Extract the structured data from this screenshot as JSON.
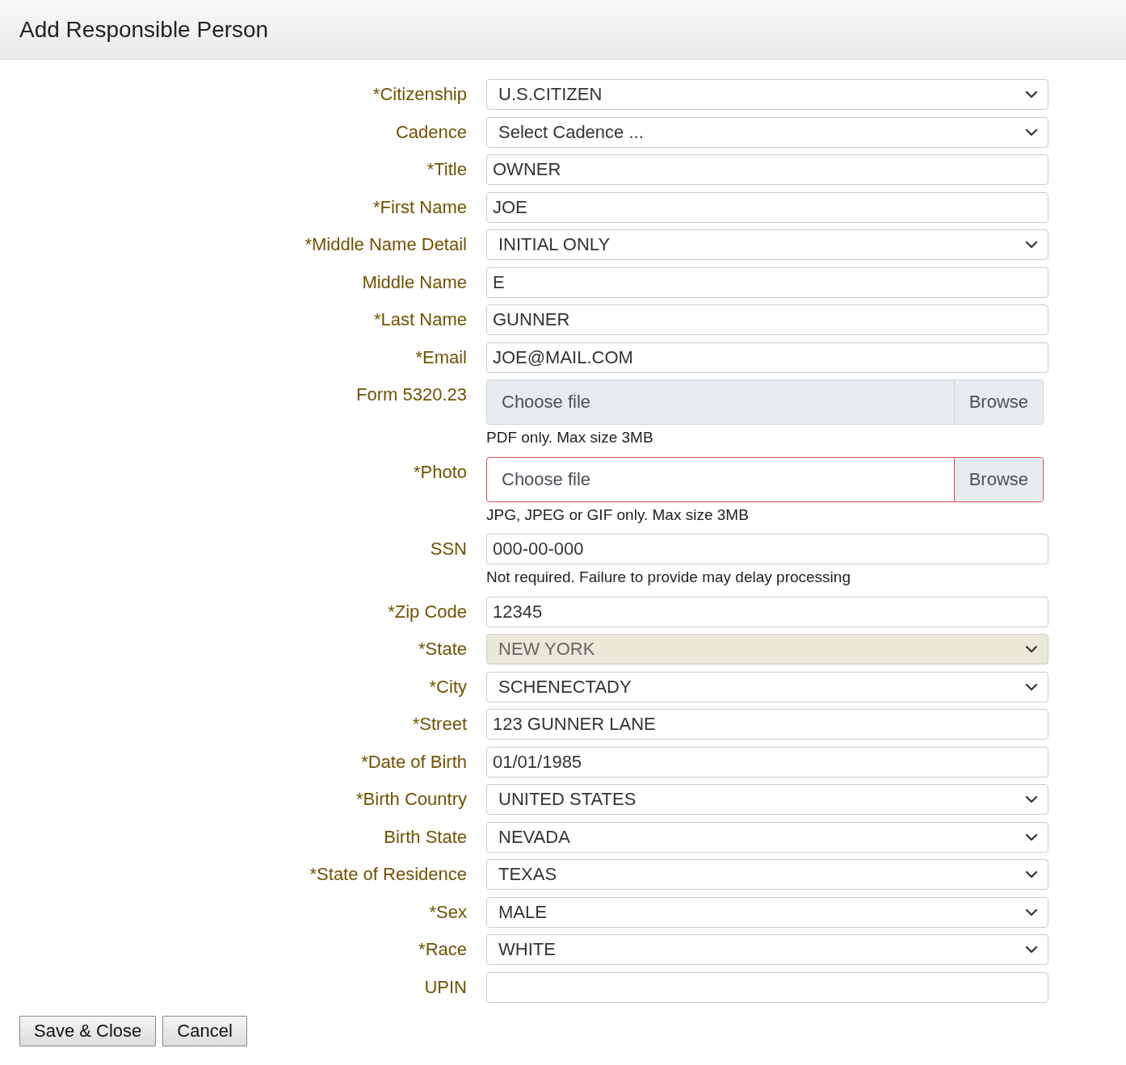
{
  "header": {
    "title": "Add Responsible Person"
  },
  "fields": [
    {
      "kind": "select",
      "label": "*Citizenship",
      "value": "U.S.CITIZEN",
      "disabled": false
    },
    {
      "kind": "select",
      "label": "Cadence",
      "value": "Select Cadence ...",
      "disabled": false
    },
    {
      "kind": "text",
      "label": "*Title",
      "value": "OWNER"
    },
    {
      "kind": "text",
      "label": "*First Name",
      "value": "JOE"
    },
    {
      "kind": "select",
      "label": "*Middle Name Detail",
      "value": "INITIAL ONLY",
      "disabled": false
    },
    {
      "kind": "text",
      "label": "Middle Name",
      "value": "E"
    },
    {
      "kind": "text",
      "label": "*Last Name",
      "value": "GUNNER"
    },
    {
      "kind": "text",
      "label": "*Email",
      "value": "JOE@MAIL.COM"
    },
    {
      "kind": "file",
      "label": "Form 5320.23",
      "value": "Choose file",
      "button": "Browse",
      "invalid": false,
      "help": "PDF only. Max size 3MB"
    },
    {
      "kind": "file",
      "label": "*Photo",
      "value": "Choose file",
      "button": "Browse",
      "invalid": true,
      "help": "JPG, JPEG or GIF only. Max size 3MB"
    },
    {
      "kind": "text",
      "label": "SSN",
      "value": "000-00-000",
      "help": "Not required. Failure to provide may delay processing"
    },
    {
      "kind": "text",
      "label": "*Zip Code",
      "value": "12345"
    },
    {
      "kind": "select",
      "label": "*State",
      "value": "NEW YORK",
      "disabled": true
    },
    {
      "kind": "select",
      "label": "*City",
      "value": "SCHENECTADY",
      "disabled": false
    },
    {
      "kind": "text",
      "label": "*Street",
      "value": "123 GUNNER LANE"
    },
    {
      "kind": "text",
      "label": "*Date of Birth",
      "value": "01/01/1985"
    },
    {
      "kind": "select",
      "label": "*Birth Country",
      "value": "UNITED STATES",
      "disabled": false
    },
    {
      "kind": "select",
      "label": "Birth State",
      "value": "NEVADA",
      "disabled": false
    },
    {
      "kind": "select",
      "label": "*State of Residence",
      "value": "TEXAS",
      "disabled": false
    },
    {
      "kind": "select",
      "label": "*Sex",
      "value": "MALE",
      "disabled": false
    },
    {
      "kind": "select",
      "label": "*Race",
      "value": "WHITE",
      "disabled": false
    },
    {
      "kind": "text",
      "label": "UPIN"
    }
  ],
  "buttons": [
    "Save & Close",
    "Cancel"
  ]
}
